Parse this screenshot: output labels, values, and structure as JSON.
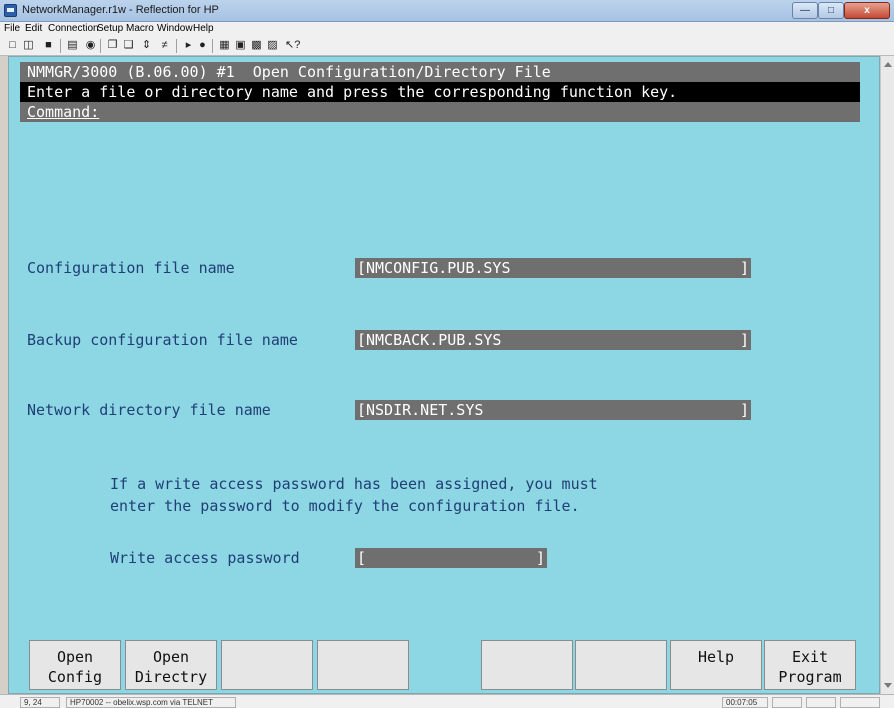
{
  "window": {
    "title": "NetworkManager.r1w - Reflection for HP",
    "close_label": "x"
  },
  "menu": [
    "File",
    "Edit",
    "Connection",
    "Setup",
    "Macro",
    "Window",
    "Help"
  ],
  "toolbar_icons": [
    "new-icon",
    "open-icon",
    "save-icon",
    "print-icon",
    "find-icon",
    "copy-icon",
    "paste-icon",
    "connect-icon",
    "disconnect-icon",
    "play-icon",
    "record-icon",
    "display-icon",
    "terminal-icon",
    "mode-icon",
    "keyboard-icon",
    "help-icon"
  ],
  "screen": {
    "header": "NMMGR/3000 (B.06.00) #1  Open Configuration/Directory File",
    "instruction": "Enter a file or directory name and press the corresponding function key.",
    "command_label": "Command:"
  },
  "fields": {
    "config_label": "Configuration file name",
    "config_value": "NMCONFIG.PUB.SYS",
    "backup_label": "Backup configuration file name",
    "backup_value": "NMCBACK.PUB.SYS",
    "netdir_label": "Network directory file name",
    "netdir_value": "NSDIR.NET.SYS",
    "password_label": "Write access password",
    "password_value": ""
  },
  "info": {
    "line1": "If a write access password has been assigned, you must",
    "line2": "enter the password to modify the configuration file."
  },
  "function_keys": [
    {
      "line1": "Open",
      "line2": "Config"
    },
    {
      "line1": "Open",
      "line2": "Directry"
    },
    {
      "line1": "",
      "line2": ""
    },
    {
      "line1": "",
      "line2": ""
    },
    {
      "line1": "",
      "line2": ""
    },
    {
      "line1": "",
      "line2": ""
    },
    {
      "line1": "Help",
      "line2": ""
    },
    {
      "line1": "Exit",
      "line2": "Program"
    }
  ],
  "status": {
    "cursor": "9, 24",
    "connection": "HP70002 -- obelix.wsp.com via TELNET",
    "time": "00:07:05"
  }
}
